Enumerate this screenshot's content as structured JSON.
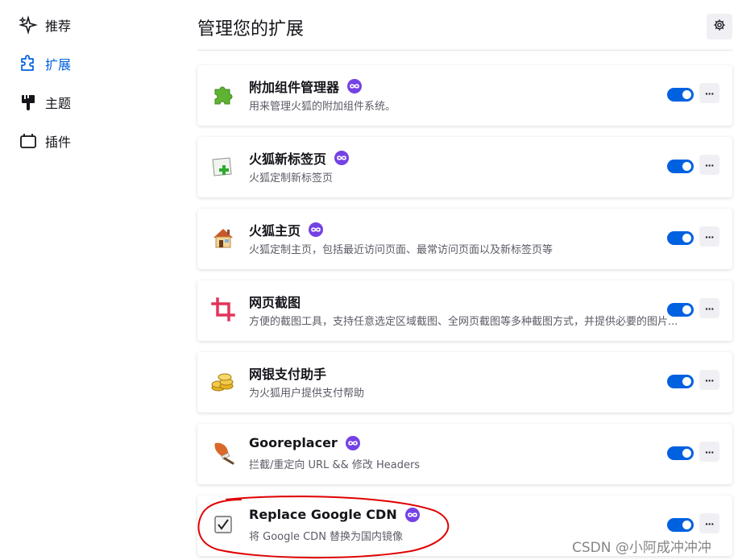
{
  "sidebar": {
    "items": [
      {
        "label": "推荐",
        "icon": "sparkle-icon",
        "active": false
      },
      {
        "label": "扩展",
        "icon": "puzzle-icon",
        "active": true
      },
      {
        "label": "主题",
        "icon": "paintbrush-icon",
        "active": false
      },
      {
        "label": "插件",
        "icon": "plugin-icon",
        "active": false
      }
    ]
  },
  "header": {
    "title": "管理您的扩展",
    "settings_icon": "gear-icon"
  },
  "extensions": [
    {
      "name": "附加组件管理器",
      "description": "用来管理火狐的附加组件系统。",
      "icon": "green-puzzle-icon",
      "badge": true,
      "enabled": true
    },
    {
      "name": "火狐新标签页",
      "description": "火狐定制新标签页",
      "icon": "new-tab-icon",
      "badge": true,
      "enabled": true
    },
    {
      "name": "火狐主页",
      "description": "火狐定制主页，包括最近访问页面、最常访问页面以及新标签页等",
      "icon": "house-icon",
      "badge": true,
      "enabled": true
    },
    {
      "name": "网页截图",
      "description": "方便的截图工具，支持任意选定区域截图、全网页截图等多种截图方式，并提供必要的图片...",
      "icon": "crop-icon",
      "badge": false,
      "enabled": true
    },
    {
      "name": "网银支付助手",
      "description": "为火狐用户提供支付帮助",
      "icon": "coins-icon",
      "badge": false,
      "enabled": true
    },
    {
      "name": "Gooreplacer",
      "description": "拦截/重定向 URL && 修改 Headers",
      "icon": "brush-icon",
      "badge": true,
      "enabled": true
    },
    {
      "name": "Replace Google CDN",
      "description": "将 Google CDN 替换为国内镜像",
      "icon": "checkbox-icon",
      "badge": true,
      "enabled": true
    }
  ],
  "more_label": "···",
  "watermark": "CSDN @小阿成冲冲冲",
  "colors": {
    "accent": "#0061e0",
    "badge": "#7542e5",
    "annotation": "#e00000"
  }
}
